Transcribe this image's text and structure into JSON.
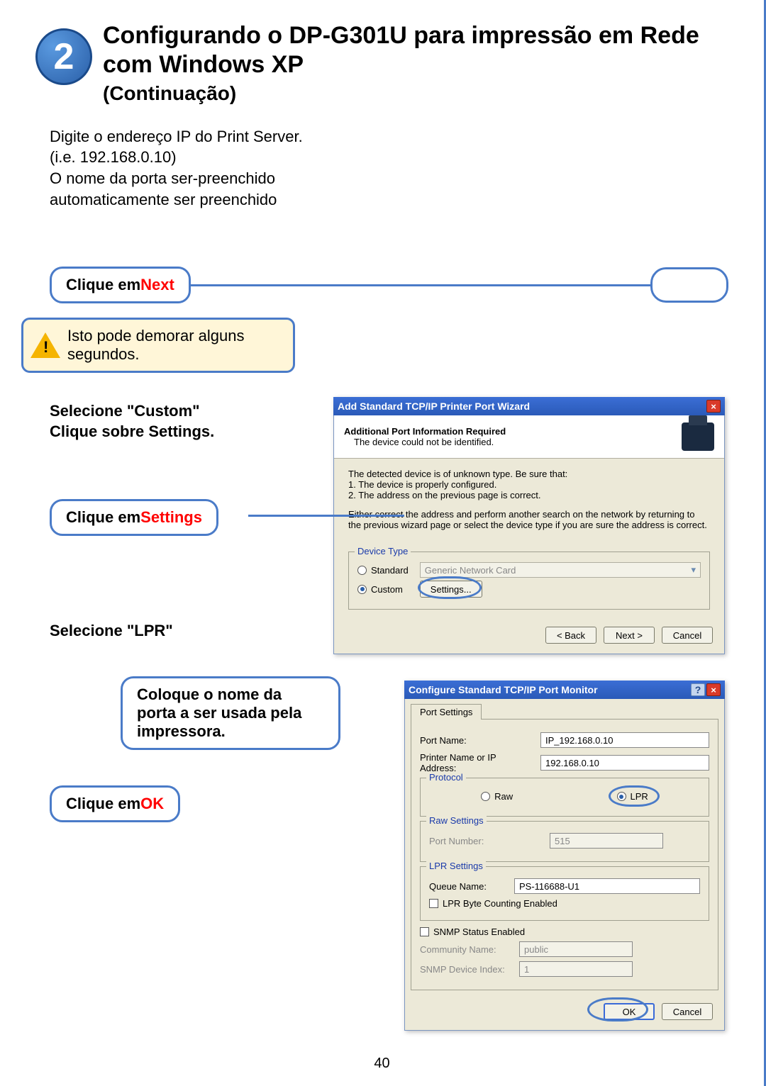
{
  "step_number": "2",
  "title": "Configurando o DP-G301U para impressão em Rede com Windows XP",
  "subtitle": "(Continuação)",
  "intro": "Digite o endereço IP do Print Server.  (i.e. 192.168.0.10)\nO nome da porta ser-preenchido automaticamente ser preenchido",
  "callouts": {
    "click_next_pre": "Clique em ",
    "click_next_red": "Next",
    "warning": "Isto pode demorar alguns segundos.",
    "select_custom": "Selecione \"Custom\"\nClique sobre Settings.",
    "click_settings_pre": "Clique em ",
    "click_settings_red": "Settings",
    "select_lpr": "Selecione \"LPR\"",
    "queue_name": "Coloque o nome da porta a ser usada pela impressora.",
    "click_ok_pre": "Clique em ",
    "click_ok_red": "OK"
  },
  "dialog1": {
    "title": "Add Standard TCP/IP Printer Port Wizard",
    "header_bold": "Additional Port Information Required",
    "header_sub": "The device could not be identified.",
    "body_line1": "The detected device is of unknown type.  Be sure that:",
    "body_b1": "1.  The device is properly configured.",
    "body_b2": "2.  The address on the previous page is correct.",
    "body_line2": "Either correct the address and perform another search on the network by returning to the previous wizard page or select the device type if you are sure the address is correct.",
    "fieldset_legend": "Device Type",
    "radio_standard": "Standard",
    "select_value": "Generic Network Card",
    "radio_custom": "Custom",
    "btn_settings": "Settings...",
    "btn_back": "< Back",
    "btn_next": "Next >",
    "btn_cancel": "Cancel"
  },
  "dialog2": {
    "title": "Configure Standard TCP/IP Port Monitor",
    "tab": "Port Settings",
    "port_name_label": "Port Name:",
    "port_name_value": "IP_192.168.0.10",
    "printer_addr_label": "Printer Name or IP Address:",
    "printer_addr_value": "192.168.0.10",
    "protocol_legend": "Protocol",
    "protocol_raw": "Raw",
    "protocol_lpr": "LPR",
    "raw_legend": "Raw Settings",
    "raw_port_label": "Port Number:",
    "raw_port_value": "515",
    "lpr_legend": "LPR Settings",
    "queue_label": "Queue Name:",
    "queue_value": "PS-116688-U1",
    "lpr_byte": "LPR Byte Counting Enabled",
    "snmp_enabled": "SNMP Status Enabled",
    "community_label": "Community Name:",
    "community_value": "public",
    "snmp_idx_label": "SNMP Device Index:",
    "snmp_idx_value": "1",
    "btn_ok": "OK",
    "btn_cancel": "Cancel"
  },
  "page_number": "40"
}
